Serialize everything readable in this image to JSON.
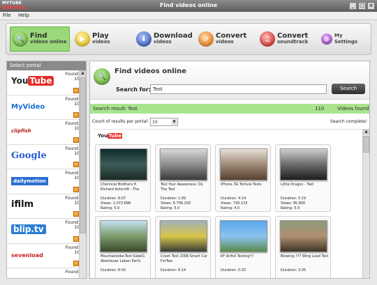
{
  "window": {
    "title": "Find videos online",
    "logo_line1": "MYTUBE",
    "logo_line2": "BIGPACK"
  },
  "menu": {
    "file": "File",
    "help": "Help"
  },
  "toolbar": {
    "find": {
      "main": "Find",
      "sub": "videos online"
    },
    "play": {
      "main": "Play",
      "sub": "videos"
    },
    "download": {
      "main": "Download",
      "sub": "videos"
    },
    "convert": {
      "main": "Convert",
      "sub": "videos"
    },
    "soundtrack": {
      "main": "Convert",
      "sub": "soundtrack"
    },
    "settings": {
      "main": "My",
      "sub": "Settings"
    }
  },
  "sidebar": {
    "title": "Select portal",
    "found_label": "Found:",
    "portals": [
      {
        "name": "YouTube",
        "found": "10"
      },
      {
        "name": "MyVideo",
        "found": "10"
      },
      {
        "name": "clipfish",
        "found": "10"
      },
      {
        "name": "Google",
        "found": "10"
      },
      {
        "name": "dailymotion",
        "found": "10"
      },
      {
        "name": "ifilm",
        "found": "10"
      },
      {
        "name": "blip.tv",
        "found": "10"
      },
      {
        "name": "sevenload",
        "found": "10"
      },
      {
        "name": "",
        "found": ""
      }
    ]
  },
  "main": {
    "title": "Find videos online",
    "search_label": "Search for:",
    "search_value": "Test",
    "search_button": "Search",
    "result_label": "Search result:",
    "result_query": "Test",
    "result_count": "110",
    "result_suffix": "Videos found",
    "count_label": "Count of results per portal:",
    "count_value": "10",
    "status": "Search complete!",
    "portal_header_you": "You",
    "portal_header_tube": "Tube"
  },
  "videos": [
    {
      "title": "Chemical Brothers ft Richard Ashcroft - The",
      "duration": "Duration: 6:07",
      "views": "Views: 1.073.896",
      "rating": "Rating: 5.0"
    },
    {
      "title": "Test Your Awareness: Do The Test",
      "duration": "Duration: 1:09",
      "views": "Views: 6.706.293",
      "rating": "Rating: 5.0"
    },
    {
      "title": "iPhone 3G Torture Tests",
      "duration": "Duration: 4:14",
      "views": "Views: 730.133",
      "rating": "Rating: 4.5"
    },
    {
      "title": "Little Dragon - Test",
      "duration": "Duration: 5:19",
      "views": "Views: 95.800",
      "rating": "Rating: 5.0"
    },
    {
      "title": "Mountainbike-Test Kabel1 Abenteuer Leben Part1",
      "duration": "Duration: 6:50",
      "views": "",
      "rating": ""
    },
    {
      "title": "Crash Test 2008 Smart Car ForTwo",
      "duration": "Duration: 6:14",
      "views": "",
      "rating": ""
    },
    {
      "title": "KF Airfoil Testing!!!",
      "duration": "Duration: 0:25",
      "views": "",
      "rating": ""
    },
    {
      "title": "Blowing ??? Wing Load Test",
      "duration": "Duration: 3:35",
      "views": "",
      "rating": ""
    }
  ]
}
